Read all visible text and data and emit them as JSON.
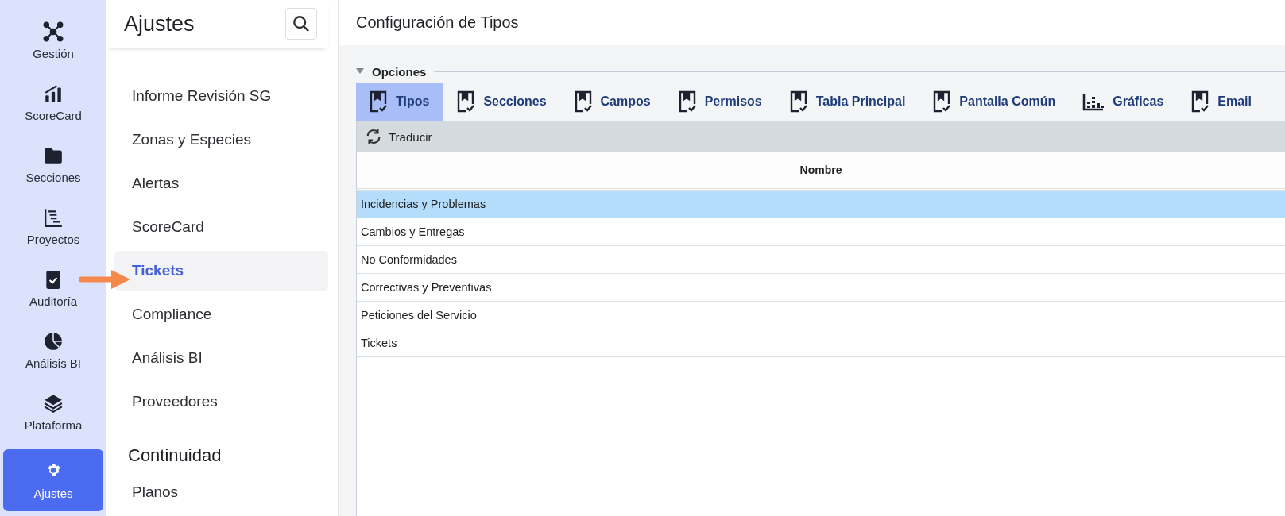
{
  "rail": [
    {
      "label": "Gestión",
      "selected": false
    },
    {
      "label": "ScoreCard",
      "selected": false
    },
    {
      "label": "Secciones",
      "selected": false
    },
    {
      "label": "Proyectos",
      "selected": false
    },
    {
      "label": "Auditoría",
      "selected": false
    },
    {
      "label": "Análisis BI",
      "selected": false
    },
    {
      "label": "Plataforma",
      "selected": false
    },
    {
      "label": "Ajustes",
      "selected": true
    }
  ],
  "settings": {
    "title": "Ajustes",
    "items": [
      {
        "label": "Informe Revisión SG",
        "selected": false
      },
      {
        "label": "Zonas y Especies",
        "selected": false
      },
      {
        "label": "Alertas",
        "selected": false
      },
      {
        "label": "ScoreCard",
        "selected": false
      },
      {
        "label": "Tickets",
        "selected": true
      },
      {
        "label": "Compliance",
        "selected": false
      },
      {
        "label": "Análisis BI",
        "selected": false
      },
      {
        "label": "Proveedores",
        "selected": false
      }
    ],
    "section": "Continuidad",
    "section_items": [
      {
        "label": "Planos",
        "selected": false
      }
    ]
  },
  "page": {
    "title": "Configuración de Tipos",
    "group": {
      "label": "Opciones",
      "expanded": true
    },
    "tabs": [
      {
        "label": "Tipos",
        "selected": true,
        "kind": "doc"
      },
      {
        "label": "Secciones",
        "selected": false,
        "kind": "doc"
      },
      {
        "label": "Campos",
        "selected": false,
        "kind": "doc"
      },
      {
        "label": "Permisos",
        "selected": false,
        "kind": "doc"
      },
      {
        "label": "Tabla Principal",
        "selected": false,
        "kind": "doc"
      },
      {
        "label": "Pantalla Común",
        "selected": false,
        "kind": "doc"
      },
      {
        "label": "Gráficas",
        "selected": false,
        "kind": "chart"
      },
      {
        "label": "Email",
        "selected": false,
        "kind": "doc"
      }
    ],
    "toolbar": {
      "button": "Traducir"
    },
    "table": {
      "columns": [
        "Nombre"
      ],
      "rows": [
        {
          "cells": [
            "Incidencias y Problemas"
          ],
          "selected": true
        },
        {
          "cells": [
            "Cambios y Entregas"
          ],
          "selected": false
        },
        {
          "cells": [
            "No Conformidades"
          ],
          "selected": false
        },
        {
          "cells": [
            "Correctivas y Preventivas"
          ],
          "selected": false
        },
        {
          "cells": [
            "Peticiones del Servicio"
          ],
          "selected": false
        },
        {
          "cells": [
            "Tickets"
          ],
          "selected": false
        }
      ]
    }
  }
}
